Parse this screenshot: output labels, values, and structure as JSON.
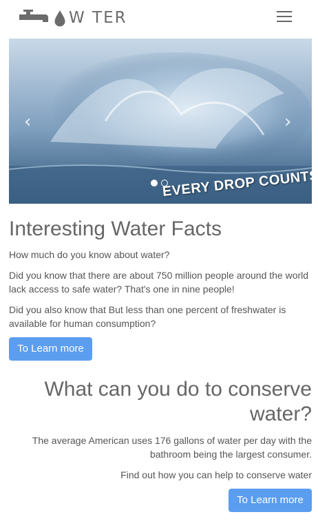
{
  "header": {
    "logo_text": "W TER",
    "menu_icon": "hamburger-menu-icon"
  },
  "carousel": {
    "caption": "EVERY DROP COUNTS",
    "prev_icon": "chevron-left-icon",
    "next_icon": "chevron-right-icon",
    "slide_count": 2,
    "active_slide": 1
  },
  "facts": {
    "heading": "Interesting Water Facts",
    "intro": "How much do you know about water?",
    "fact1": "Did you know that there are about 750 million people around the world lack access to safe water? That's one in nine people!",
    "fact2": "Did you also know that But less than one percent of freshwater is available for human consumption?",
    "button_label": "To Learn more"
  },
  "conserve": {
    "heading": "What can you do to conserve water?",
    "usage_text": "The average American uses 176 gallons of water per day with the bathroom being the largest consumer.",
    "help_text": "Find out how you can help to conserve water",
    "button_label": "To Learn more"
  },
  "colors": {
    "accent": "#5b9ef0",
    "text": "#555555",
    "heading": "#666666"
  }
}
